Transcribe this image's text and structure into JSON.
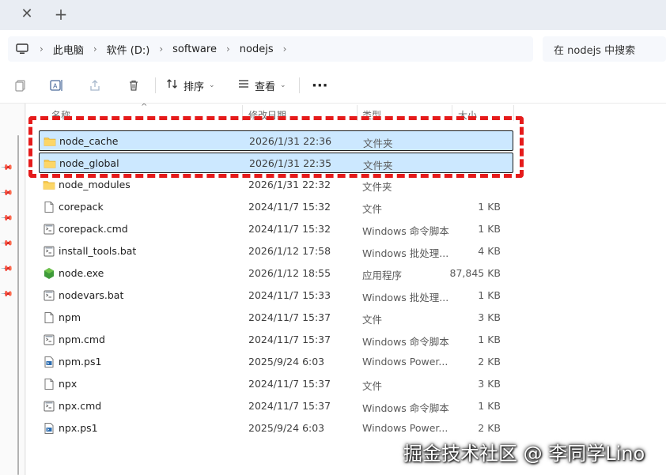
{
  "tabs": {
    "close_icon": "close-icon",
    "new_tab_icon": "plus-icon"
  },
  "address": {
    "crumbs": [
      "此电脑",
      "软件 (D:)",
      "software",
      "nodejs"
    ],
    "search_placeholder": "在 nodejs 中搜索"
  },
  "commandbar": {
    "sort_label": "排序",
    "view_label": "查看",
    "more_label": "···"
  },
  "columns": {
    "name": "名称",
    "modified": "修改日期",
    "type": "类型",
    "size": "大小"
  },
  "files": [
    {
      "name": "node_cache",
      "modified": "2026/1/31 22:36",
      "type": "文件夹",
      "size": "",
      "icon": "folder-icon",
      "selected": true
    },
    {
      "name": "node_global",
      "modified": "2026/1/31 22:35",
      "type": "文件夹",
      "size": "",
      "icon": "folder-icon",
      "selected": true
    },
    {
      "name": "node_modules",
      "modified": "2026/1/31 22:32",
      "type": "文件夹",
      "size": "",
      "icon": "folder-icon",
      "selected": false
    },
    {
      "name": "corepack",
      "modified": "2024/11/7 15:32",
      "type": "文件",
      "size": "1 KB",
      "icon": "file-icon",
      "selected": false
    },
    {
      "name": "corepack.cmd",
      "modified": "2024/11/7 15:32",
      "type": "Windows 命令脚本",
      "size": "1 KB",
      "icon": "script-icon",
      "selected": false
    },
    {
      "name": "install_tools.bat",
      "modified": "2026/1/12 17:58",
      "type": "Windows 批处理...",
      "size": "4 KB",
      "icon": "script-icon",
      "selected": false
    },
    {
      "name": "node.exe",
      "modified": "2026/1/12 18:55",
      "type": "应用程序",
      "size": "87,845 KB",
      "icon": "node-exe-icon",
      "selected": false
    },
    {
      "name": "nodevars.bat",
      "modified": "2024/11/7 15:33",
      "type": "Windows 批处理...",
      "size": "1 KB",
      "icon": "script-icon",
      "selected": false
    },
    {
      "name": "npm",
      "modified": "2024/11/7 15:37",
      "type": "文件",
      "size": "3 KB",
      "icon": "file-icon",
      "selected": false
    },
    {
      "name": "npm.cmd",
      "modified": "2024/11/7 15:37",
      "type": "Windows 命令脚本",
      "size": "1 KB",
      "icon": "script-icon",
      "selected": false
    },
    {
      "name": "npm.ps1",
      "modified": "2025/9/24 6:03",
      "type": "Windows Power...",
      "size": "2 KB",
      "icon": "powershell-icon",
      "selected": false
    },
    {
      "name": "npx",
      "modified": "2024/11/7 15:37",
      "type": "文件",
      "size": "3 KB",
      "icon": "file-icon",
      "selected": false
    },
    {
      "name": "npx.cmd",
      "modified": "2024/11/7 15:37",
      "type": "Windows 命令脚本",
      "size": "1 KB",
      "icon": "script-icon",
      "selected": false
    },
    {
      "name": "npx.ps1",
      "modified": "2025/9/24 6:03",
      "type": "Windows Power...",
      "size": "2 KB",
      "icon": "powershell-icon",
      "selected": false
    }
  ],
  "watermark": "掘金技术社区 @ 李同学Lino",
  "colors": {
    "selection": "#cce8ff",
    "highlight": "#e51b1b",
    "folder": "#f8c94a"
  }
}
